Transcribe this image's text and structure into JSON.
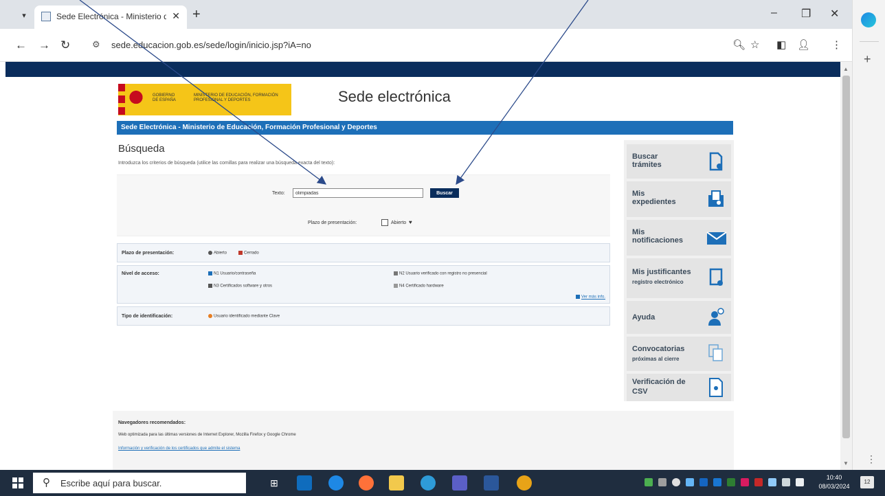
{
  "browser": {
    "tab_title": "Sede Electrónica - Ministerio de ...",
    "tab_close": "✕",
    "new_tab": "+",
    "url": "sede.educacion.gob.es/sede/login/inicio.jsp?iA=no",
    "win_min": "–",
    "win_max": "❐",
    "win_close": "✕"
  },
  "site": {
    "title": "Sede electrónica",
    "logo_gov": "GOBIERNO DE ESPAÑA",
    "logo_ministry": "MINISTERIO DE EDUCACIÓN, FORMACIÓN PROFESIONAL Y DEPORTES",
    "banner": "Sede Electrónica - Ministerio de Educación, Formación Profesional y Deportes",
    "heading": "Búsqueda",
    "intro": "Introduzca los criterios de búsqueda (utilice las comillas para realizar una búsqueda exacta del texto):",
    "search": {
      "label": "Texto:",
      "value": "olimpiadas",
      "button": "Buscar",
      "plazo_label": "Plazo de presentación:",
      "abierto_label": "Abierto"
    },
    "legend": {
      "plazo_title": "Plazo de presentación:",
      "abierto": "Abierto",
      "cerrado": "Cerrado",
      "nivel_title": "Nivel de acceso:",
      "n1": "N1  Usuario/contraseña",
      "n2": "N2  Usuario verificado con registro no presencial",
      "n3": "N3  Certificados software y otros",
      "n4": "N4  Certificado hardware",
      "ver_mas": "Ver más info.",
      "tipo_title": "Tipo de identificación:",
      "tipo_value": "Usuario identificado mediante Clave"
    },
    "sidebar": [
      {
        "label": "Buscar",
        "label2": "trámites"
      },
      {
        "label": "Mis",
        "label2": "expedientes"
      },
      {
        "label": "Mis",
        "label2": "notificaciones"
      },
      {
        "label": "Mis justificantes",
        "label2": "registro electrónico"
      },
      {
        "label": "Ayuda",
        "label2": ""
      },
      {
        "label": "Convocatorias",
        "label2": "próximas al cierre"
      },
      {
        "label": "Verificación de",
        "label2": "CSV"
      }
    ],
    "footer": {
      "title": "Navegadores recomendados:",
      "text": "Web optimizada para las últimas versiones de Internet Explorer, Mozilla Firefox y Google Chrome",
      "link": "Información y verificación de los certificados que admite el sistema"
    }
  },
  "taskbar": {
    "search_placeholder": "Escribe aquí para buscar.",
    "time": "10:40",
    "date": "08/03/2024",
    "notifications": "12"
  },
  "colors": {
    "banner": "#1d6fb8",
    "topband": "#0a2d5c",
    "annotation": "#2b4a8a"
  }
}
